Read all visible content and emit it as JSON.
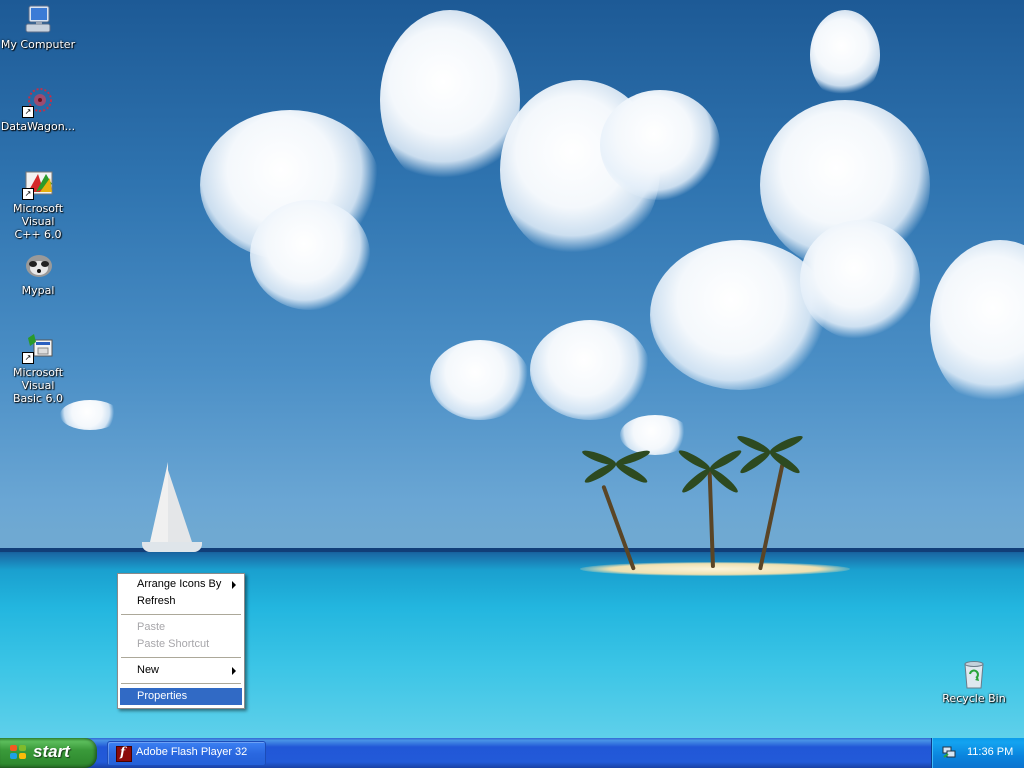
{
  "desktop_icons": [
    {
      "label": "My Computer",
      "icon": "my-computer-icon"
    },
    {
      "label": "DataWagon...",
      "icon": "datawagon-icon"
    },
    {
      "label": "Microsoft Visual\nC++ 6.0",
      "icon": "visual-cpp-icon"
    },
    {
      "label": "Mypal",
      "icon": "mypal-icon"
    },
    {
      "label": "Microsoft Visual\nBasic 6.0",
      "icon": "visual-basic-icon"
    },
    {
      "label": "Recycle Bin",
      "icon": "recycle-bin-icon"
    }
  ],
  "context_menu": {
    "items": [
      {
        "label": "Arrange Icons By",
        "has_submenu": true,
        "enabled": true
      },
      {
        "label": "Refresh",
        "enabled": true
      },
      {
        "label": "Paste",
        "enabled": false
      },
      {
        "label": "Paste Shortcut",
        "enabled": false
      },
      {
        "label": "New",
        "has_submenu": true,
        "enabled": true
      },
      {
        "label": "Properties",
        "enabled": true,
        "highlighted": true
      }
    ]
  },
  "taskbar": {
    "start_label": "start",
    "tasks": [
      {
        "label": "Adobe Flash Player 32",
        "icon": "flash-player-icon"
      }
    ],
    "clock": "11:36 PM"
  },
  "colors": {
    "selection": "#316ac5",
    "taskbar": "#245edb",
    "start_button": "#3c9a3c",
    "tray": "#0c9bea"
  }
}
